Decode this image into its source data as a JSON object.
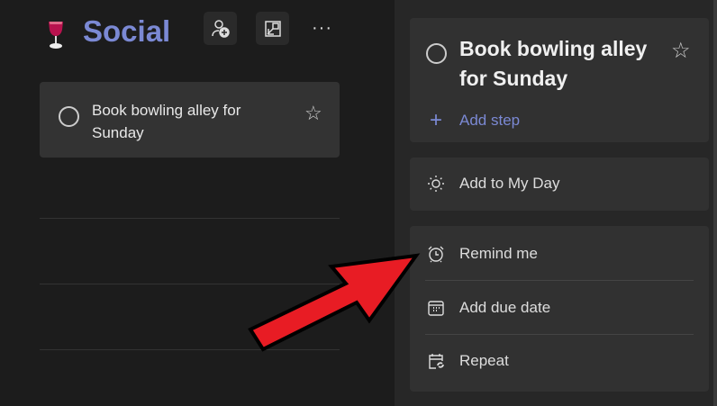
{
  "list": {
    "title": "Social",
    "emoji_icon": "wine-glass-icon",
    "more_label": "···",
    "task": {
      "title": "Book bowling alley for Sunday"
    }
  },
  "detail": {
    "task_title": "Book bowling alley for Sunday",
    "add_step": "Add step",
    "add_my_day": "Add to My Day",
    "remind_me": "Remind me",
    "add_due_date": "Add due date",
    "repeat": "Repeat"
  },
  "colors": {
    "accent": "#7b89d4",
    "arrow": "#e81c24"
  }
}
